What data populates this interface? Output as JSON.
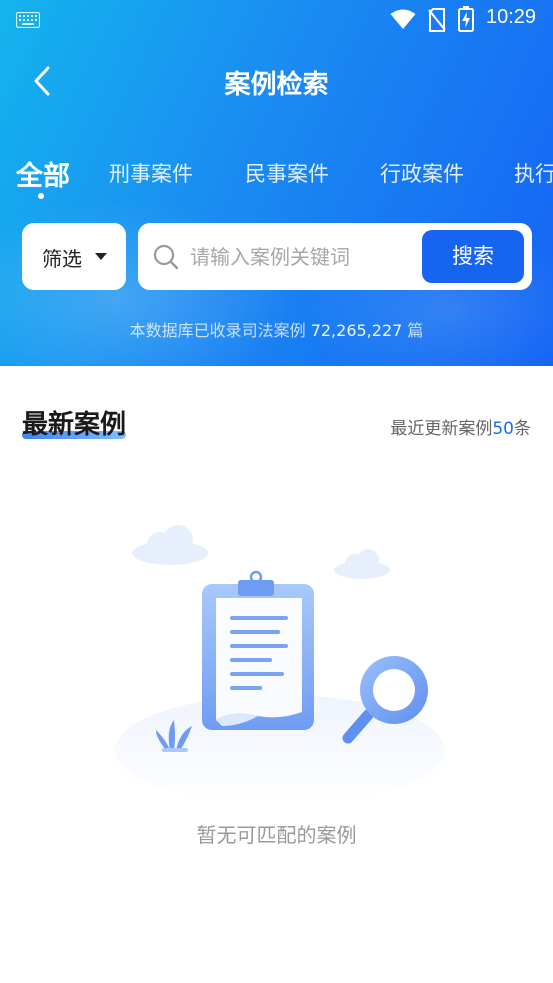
{
  "status_bar": {
    "time": "10:29"
  },
  "header": {
    "title": "案例检索",
    "back_icon": "chevron-left-icon"
  },
  "tabs": [
    {
      "label": "全部",
      "active": true
    },
    {
      "label": "刑事案件",
      "active": false
    },
    {
      "label": "民事案件",
      "active": false
    },
    {
      "label": "行政案件",
      "active": false
    },
    {
      "label": "执行",
      "active": false
    }
  ],
  "filter": {
    "label": "筛选"
  },
  "search": {
    "placeholder": "请输入案例关键词",
    "value": "",
    "button_label": "搜索"
  },
  "database_note": {
    "prefix": "本数据库已收录司法案例",
    "count": "72,265,227",
    "suffix": "篇"
  },
  "latest": {
    "title": "最新案例",
    "update_prefix": "最近更新案例",
    "update_count": "50",
    "update_suffix": "条"
  },
  "empty_state": {
    "message": "暂无可匹配的案例"
  },
  "colors": {
    "primary": "#1664f0",
    "header_gradient_start": "#14b4ee",
    "header_gradient_end": "#1563f4"
  }
}
